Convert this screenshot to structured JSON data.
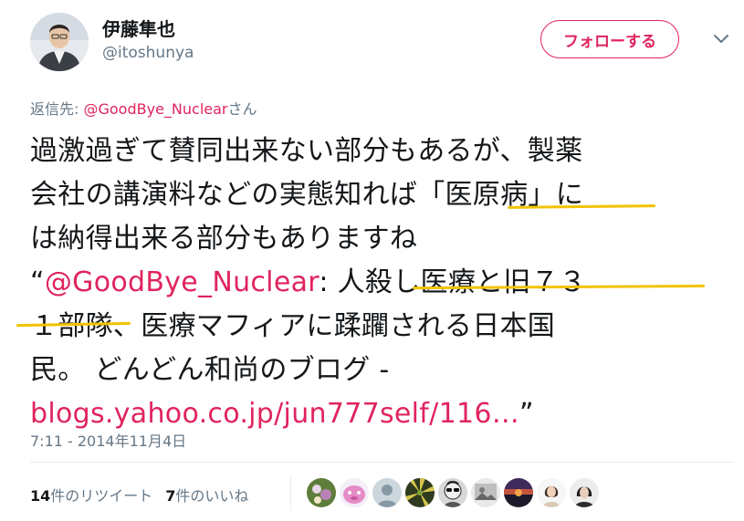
{
  "author": {
    "display_name": "伊藤隼也",
    "handle": "@itoshunya",
    "avatar_icon": "profile-photo-icon"
  },
  "follow_button_label": "フォローする",
  "reply_to": {
    "prefix": "返信先: ",
    "mention": "@GoodBye_Nuclear",
    "suffix": "さん"
  },
  "tweet": {
    "line1": "過激過ぎて賛同出来ない部分もあるが、製薬",
    "line2": "会社の講演料などの実態知れば「医原病」に",
    "line3": "は納得出来る部分もありますね",
    "line4_open": "“",
    "line4_mention": "@GoodBye_Nuclear",
    "line4_rest": ": 人殺し医療と旧７３",
    "line5": "１部隊、医療マフィアに蹂躙される日本国",
    "line6": "民。 どんどん和尚のブログ -",
    "line7_link": "blogs.yahoo.co.jp/jun777self/116…",
    "line7_close": "”"
  },
  "timestamp": "7:11 - 2014年11月4日",
  "stats": {
    "retweets_count": "14",
    "retweets_label": "件のリツイート",
    "likes_count": "7",
    "likes_label": "件のいいね"
  },
  "likers": [
    {
      "icon": "liker-avatar-flowers-icon"
    },
    {
      "icon": "liker-avatar-pink-character-icon"
    },
    {
      "icon": "liker-avatar-default-icon"
    },
    {
      "icon": "liker-avatar-green-pattern-icon"
    },
    {
      "icon": "liker-avatar-sunglasses-icon"
    },
    {
      "icon": "liker-avatar-photo-icon"
    },
    {
      "icon": "liker-avatar-sunset-icon"
    },
    {
      "icon": "liker-avatar-woman-icon"
    },
    {
      "icon": "liker-avatar-portrait-icon"
    }
  ],
  "colors": {
    "accent": "#e0245e",
    "muted": "#657786",
    "highlight": "#f2c300"
  }
}
